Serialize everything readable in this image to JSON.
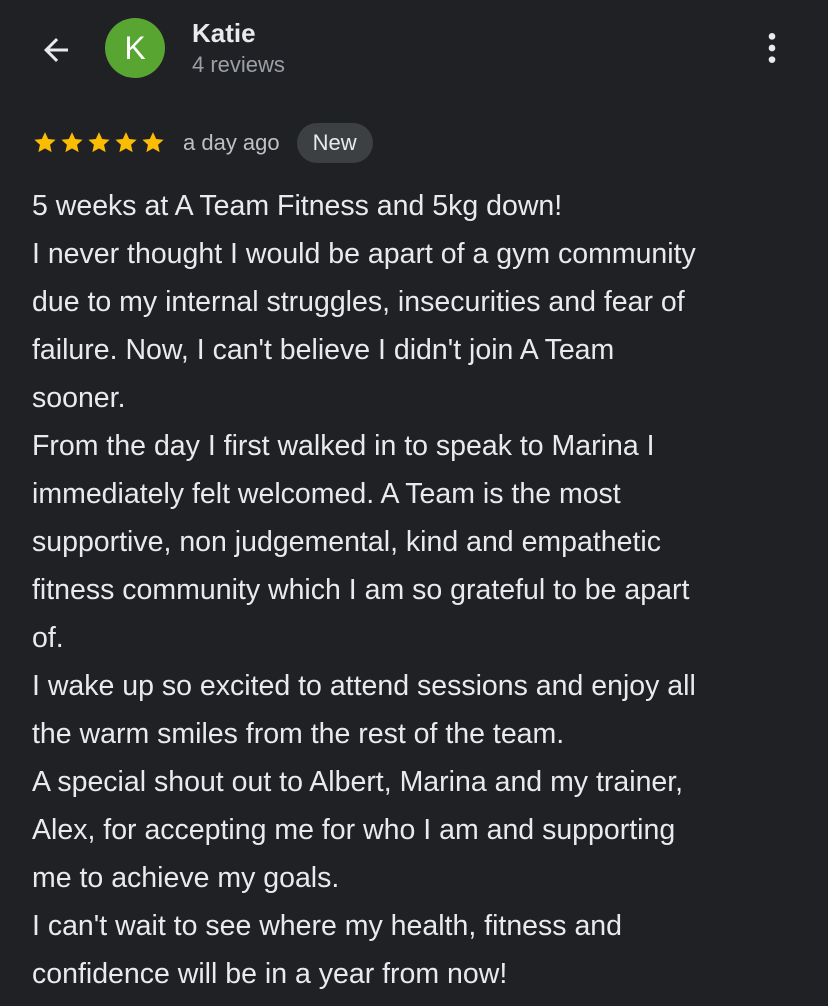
{
  "header": {
    "back_icon": "arrow-left-icon",
    "avatar_letter": "K",
    "avatar_color": "#58a531",
    "author_name": "Katie",
    "author_reviews": "4 reviews",
    "more_icon": "more-vertical-icon"
  },
  "review": {
    "rating": 5,
    "rating_max": 5,
    "star_color": "#fbbc04",
    "time_ago": "a day ago",
    "badge": "New",
    "lines": [
      "5 weeks at A Team Fitness and 5kg down!",
      "I never thought I would be apart of a gym community",
      "due to my internal struggles, insecurities and fear of",
      "failure. Now, I can't believe I didn't join A Team",
      "sooner.",
      "From the day I first walked in to speak to Marina I",
      "immediately felt welcomed. A Team is the most",
      "supportive, non judgemental, kind and empathetic",
      "fitness community which I am so grateful to be apart",
      "of.",
      "I wake up so excited to attend sessions and enjoy all",
      "the warm smiles from the rest of the team.",
      "A special shout out to Albert, Marina and my trainer,",
      "Alex, for accepting me for who I am and supporting",
      "me to achieve my goals.",
      "I can't wait to see where my health, fitness and",
      "confidence will be in a year from now!"
    ]
  }
}
